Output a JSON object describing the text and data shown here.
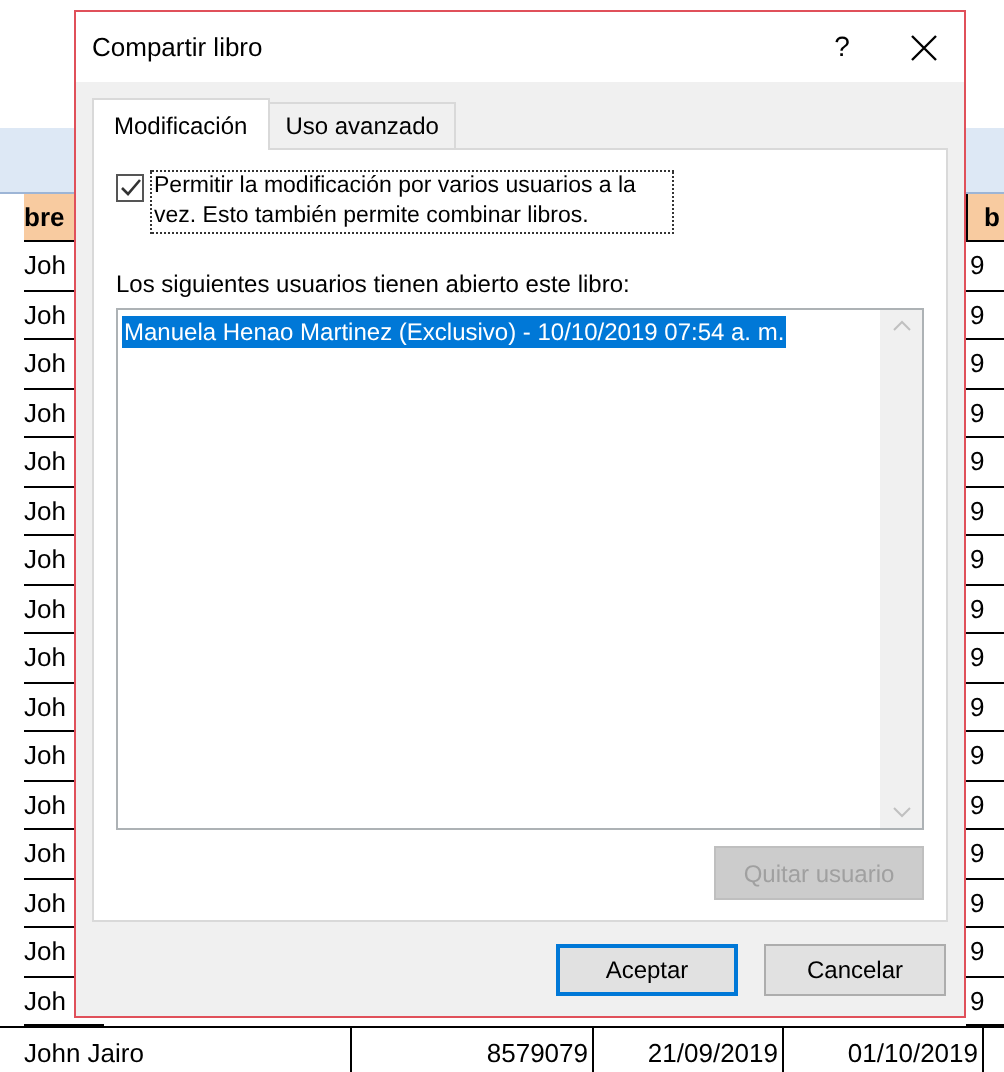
{
  "sheet": {
    "header_left": "bre",
    "header_right": "b",
    "rows": [
      {
        "name": "Joh",
        "value": "9"
      },
      {
        "name": "Joh",
        "value": "9"
      },
      {
        "name": "Joh",
        "value": "9"
      },
      {
        "name": "Joh",
        "value": "9"
      },
      {
        "name": "Joh",
        "value": "9"
      },
      {
        "name": "Joh",
        "value": "9"
      },
      {
        "name": "Joh",
        "value": "9"
      },
      {
        "name": "Joh",
        "value": "9"
      },
      {
        "name": "Joh",
        "value": "9"
      },
      {
        "name": "Joh",
        "value": "9"
      },
      {
        "name": "Joh",
        "value": "9"
      },
      {
        "name": "Joh",
        "value": "9"
      },
      {
        "name": "Joh",
        "value": "9"
      },
      {
        "name": "Joh",
        "value": "9"
      },
      {
        "name": "Joh",
        "value": "9"
      },
      {
        "name": "Joh",
        "value": "9"
      }
    ],
    "last_row": [
      "John Jairo",
      "8579079",
      "21/09/2019",
      "01/10/2019"
    ]
  },
  "dialog": {
    "title": "Compartir libro",
    "help": "?",
    "tabs": [
      {
        "label": "Modificación",
        "selected": true
      },
      {
        "label": "Uso avanzado",
        "selected": false
      }
    ],
    "option": {
      "label": "Permitir la modificación por varios usuarios a la vez. Esto también permite combinar libros.",
      "checked": true
    },
    "list_label": "Los siguientes usuarios tienen abierto este libro:",
    "users": [
      {
        "text": "Manuela Henao Martinez (Exclusivo) - 10/10/2019 07:54 a. m.",
        "selected": true
      }
    ],
    "remove_button": {
      "label": "Quitar usuario",
      "disabled": true
    },
    "buttons": [
      {
        "label": "Aceptar",
        "default": true
      },
      {
        "label": "Cancelar",
        "default": false
      }
    ]
  }
}
